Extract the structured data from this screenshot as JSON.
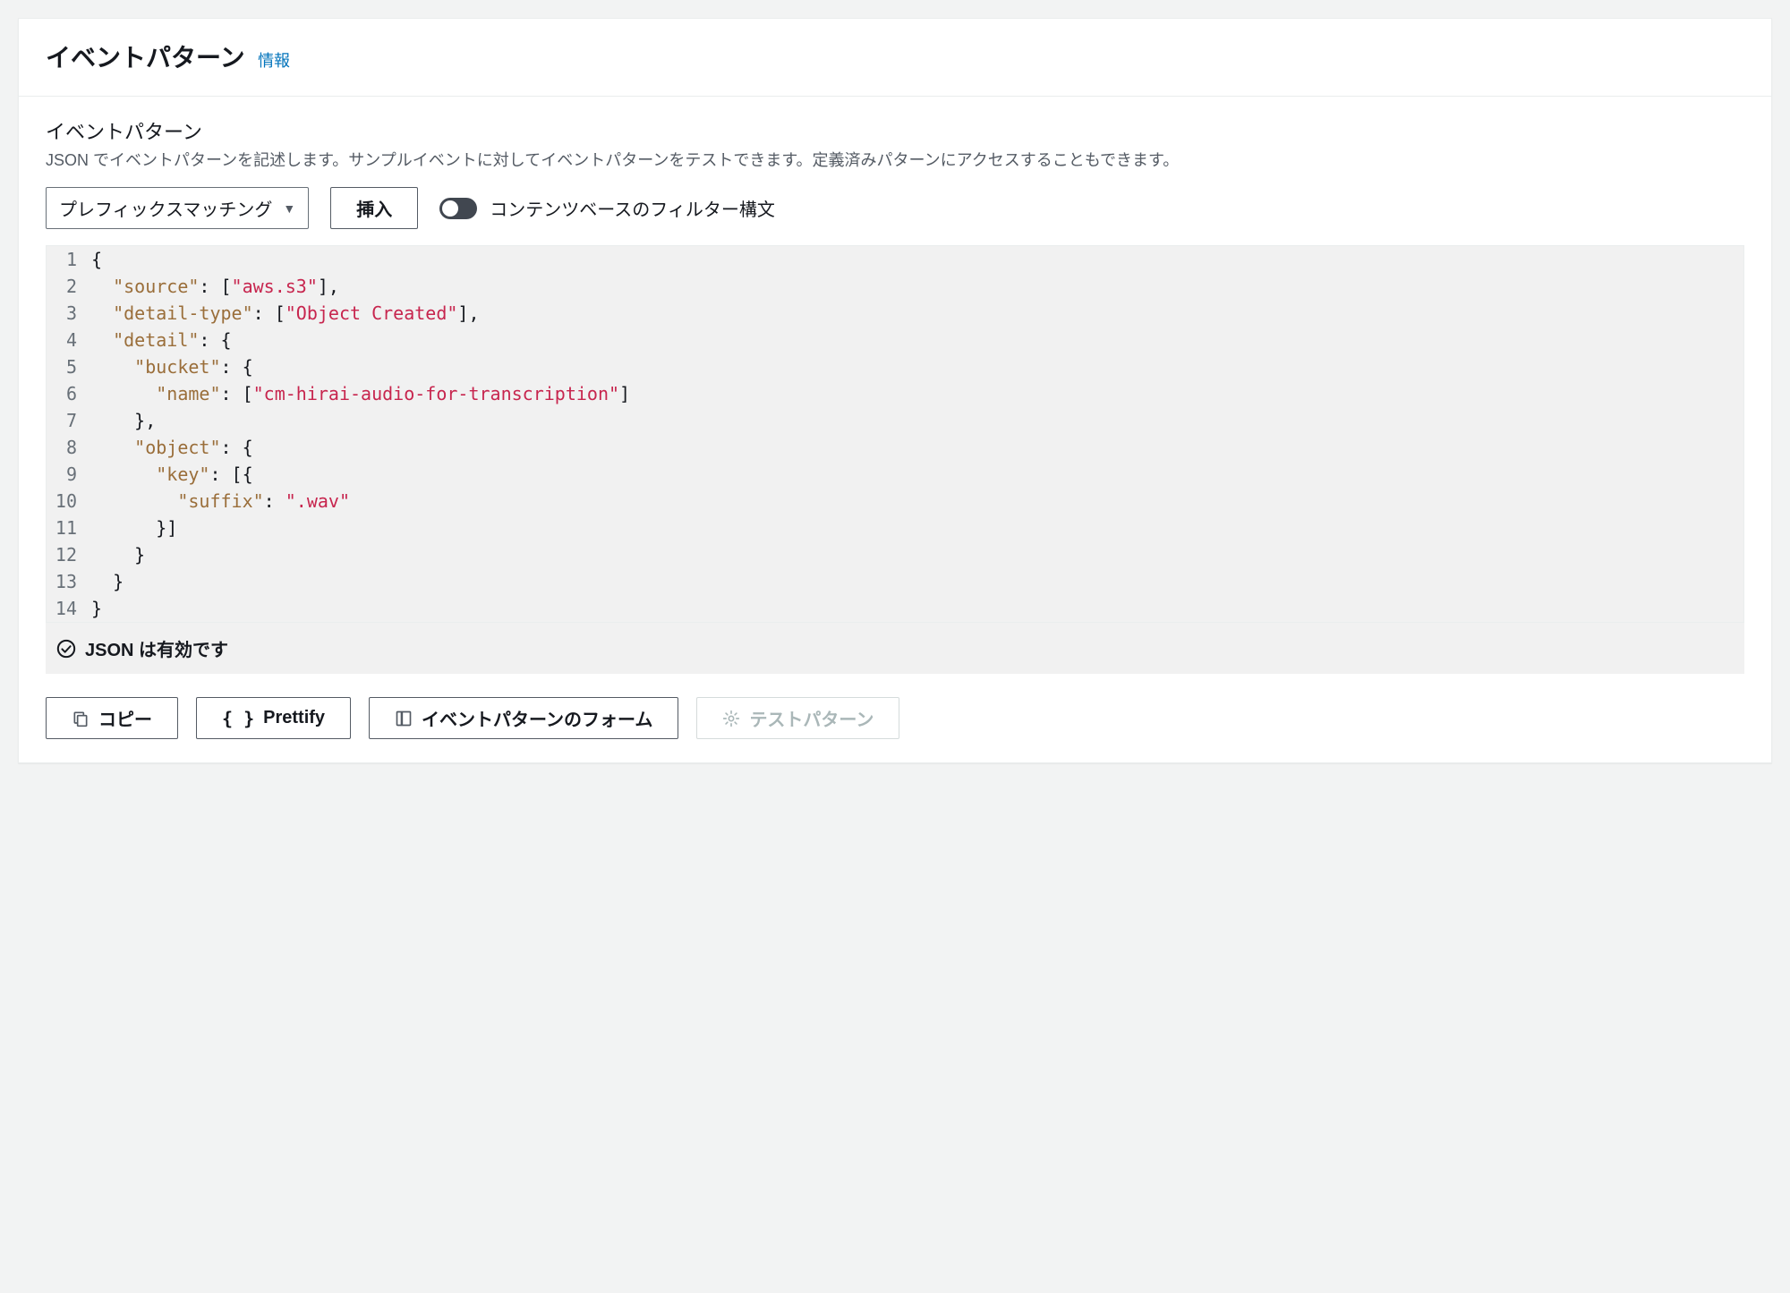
{
  "header": {
    "title": "イベントパターン",
    "info": "情報"
  },
  "subsection": {
    "title": "イベントパターン",
    "desc": "JSON でイベントパターンを記述します。サンプルイベントに対してイベントパターンをテストできます。定義済みパターンにアクセスすることもできます。"
  },
  "controls": {
    "dropdown_label": "プレフィックスマッチング",
    "insert_label": "挿入",
    "toggle_label": "コンテンツベースのフィルター構文"
  },
  "editor": {
    "lines": [
      {
        "n": 1,
        "tokens": [
          {
            "t": "punc",
            "v": "{"
          }
        ]
      },
      {
        "n": 2,
        "tokens": [
          {
            "t": "punc",
            "v": "  "
          },
          {
            "t": "key",
            "v": "\"source\""
          },
          {
            "t": "punc",
            "v": ": ["
          },
          {
            "t": "str",
            "v": "\"aws.s3\""
          },
          {
            "t": "punc",
            "v": "],"
          }
        ]
      },
      {
        "n": 3,
        "tokens": [
          {
            "t": "punc",
            "v": "  "
          },
          {
            "t": "key",
            "v": "\"detail-type\""
          },
          {
            "t": "punc",
            "v": ": ["
          },
          {
            "t": "str",
            "v": "\"Object Created\""
          },
          {
            "t": "punc",
            "v": "],"
          }
        ]
      },
      {
        "n": 4,
        "tokens": [
          {
            "t": "punc",
            "v": "  "
          },
          {
            "t": "key",
            "v": "\"detail\""
          },
          {
            "t": "punc",
            "v": ": {"
          }
        ]
      },
      {
        "n": 5,
        "tokens": [
          {
            "t": "punc",
            "v": "    "
          },
          {
            "t": "key",
            "v": "\"bucket\""
          },
          {
            "t": "punc",
            "v": ": {"
          }
        ]
      },
      {
        "n": 6,
        "tokens": [
          {
            "t": "punc",
            "v": "      "
          },
          {
            "t": "key",
            "v": "\"name\""
          },
          {
            "t": "punc",
            "v": ": ["
          },
          {
            "t": "str",
            "v": "\"cm-hirai-audio-for-transcription\""
          },
          {
            "t": "punc",
            "v": "]"
          }
        ]
      },
      {
        "n": 7,
        "tokens": [
          {
            "t": "punc",
            "v": "    },"
          }
        ]
      },
      {
        "n": 8,
        "tokens": [
          {
            "t": "punc",
            "v": "    "
          },
          {
            "t": "key",
            "v": "\"object\""
          },
          {
            "t": "punc",
            "v": ": {"
          }
        ]
      },
      {
        "n": 9,
        "tokens": [
          {
            "t": "punc",
            "v": "      "
          },
          {
            "t": "key",
            "v": "\"key\""
          },
          {
            "t": "punc",
            "v": ": [{"
          }
        ]
      },
      {
        "n": 10,
        "tokens": [
          {
            "t": "punc",
            "v": "        "
          },
          {
            "t": "key",
            "v": "\"suffix\""
          },
          {
            "t": "punc",
            "v": ": "
          },
          {
            "t": "str",
            "v": "\".wav\""
          }
        ]
      },
      {
        "n": 11,
        "tokens": [
          {
            "t": "punc",
            "v": "      }]"
          }
        ]
      },
      {
        "n": 12,
        "tokens": [
          {
            "t": "punc",
            "v": "    }"
          }
        ]
      },
      {
        "n": 13,
        "tokens": [
          {
            "t": "punc",
            "v": "  }"
          }
        ]
      },
      {
        "n": 14,
        "tokens": [
          {
            "t": "punc",
            "v": "}"
          }
        ]
      }
    ],
    "status": "JSON は有効です"
  },
  "buttons": {
    "copy": "コピー",
    "prettify": "Prettify",
    "form": "イベントパターンのフォーム",
    "test": "テストパターン"
  }
}
